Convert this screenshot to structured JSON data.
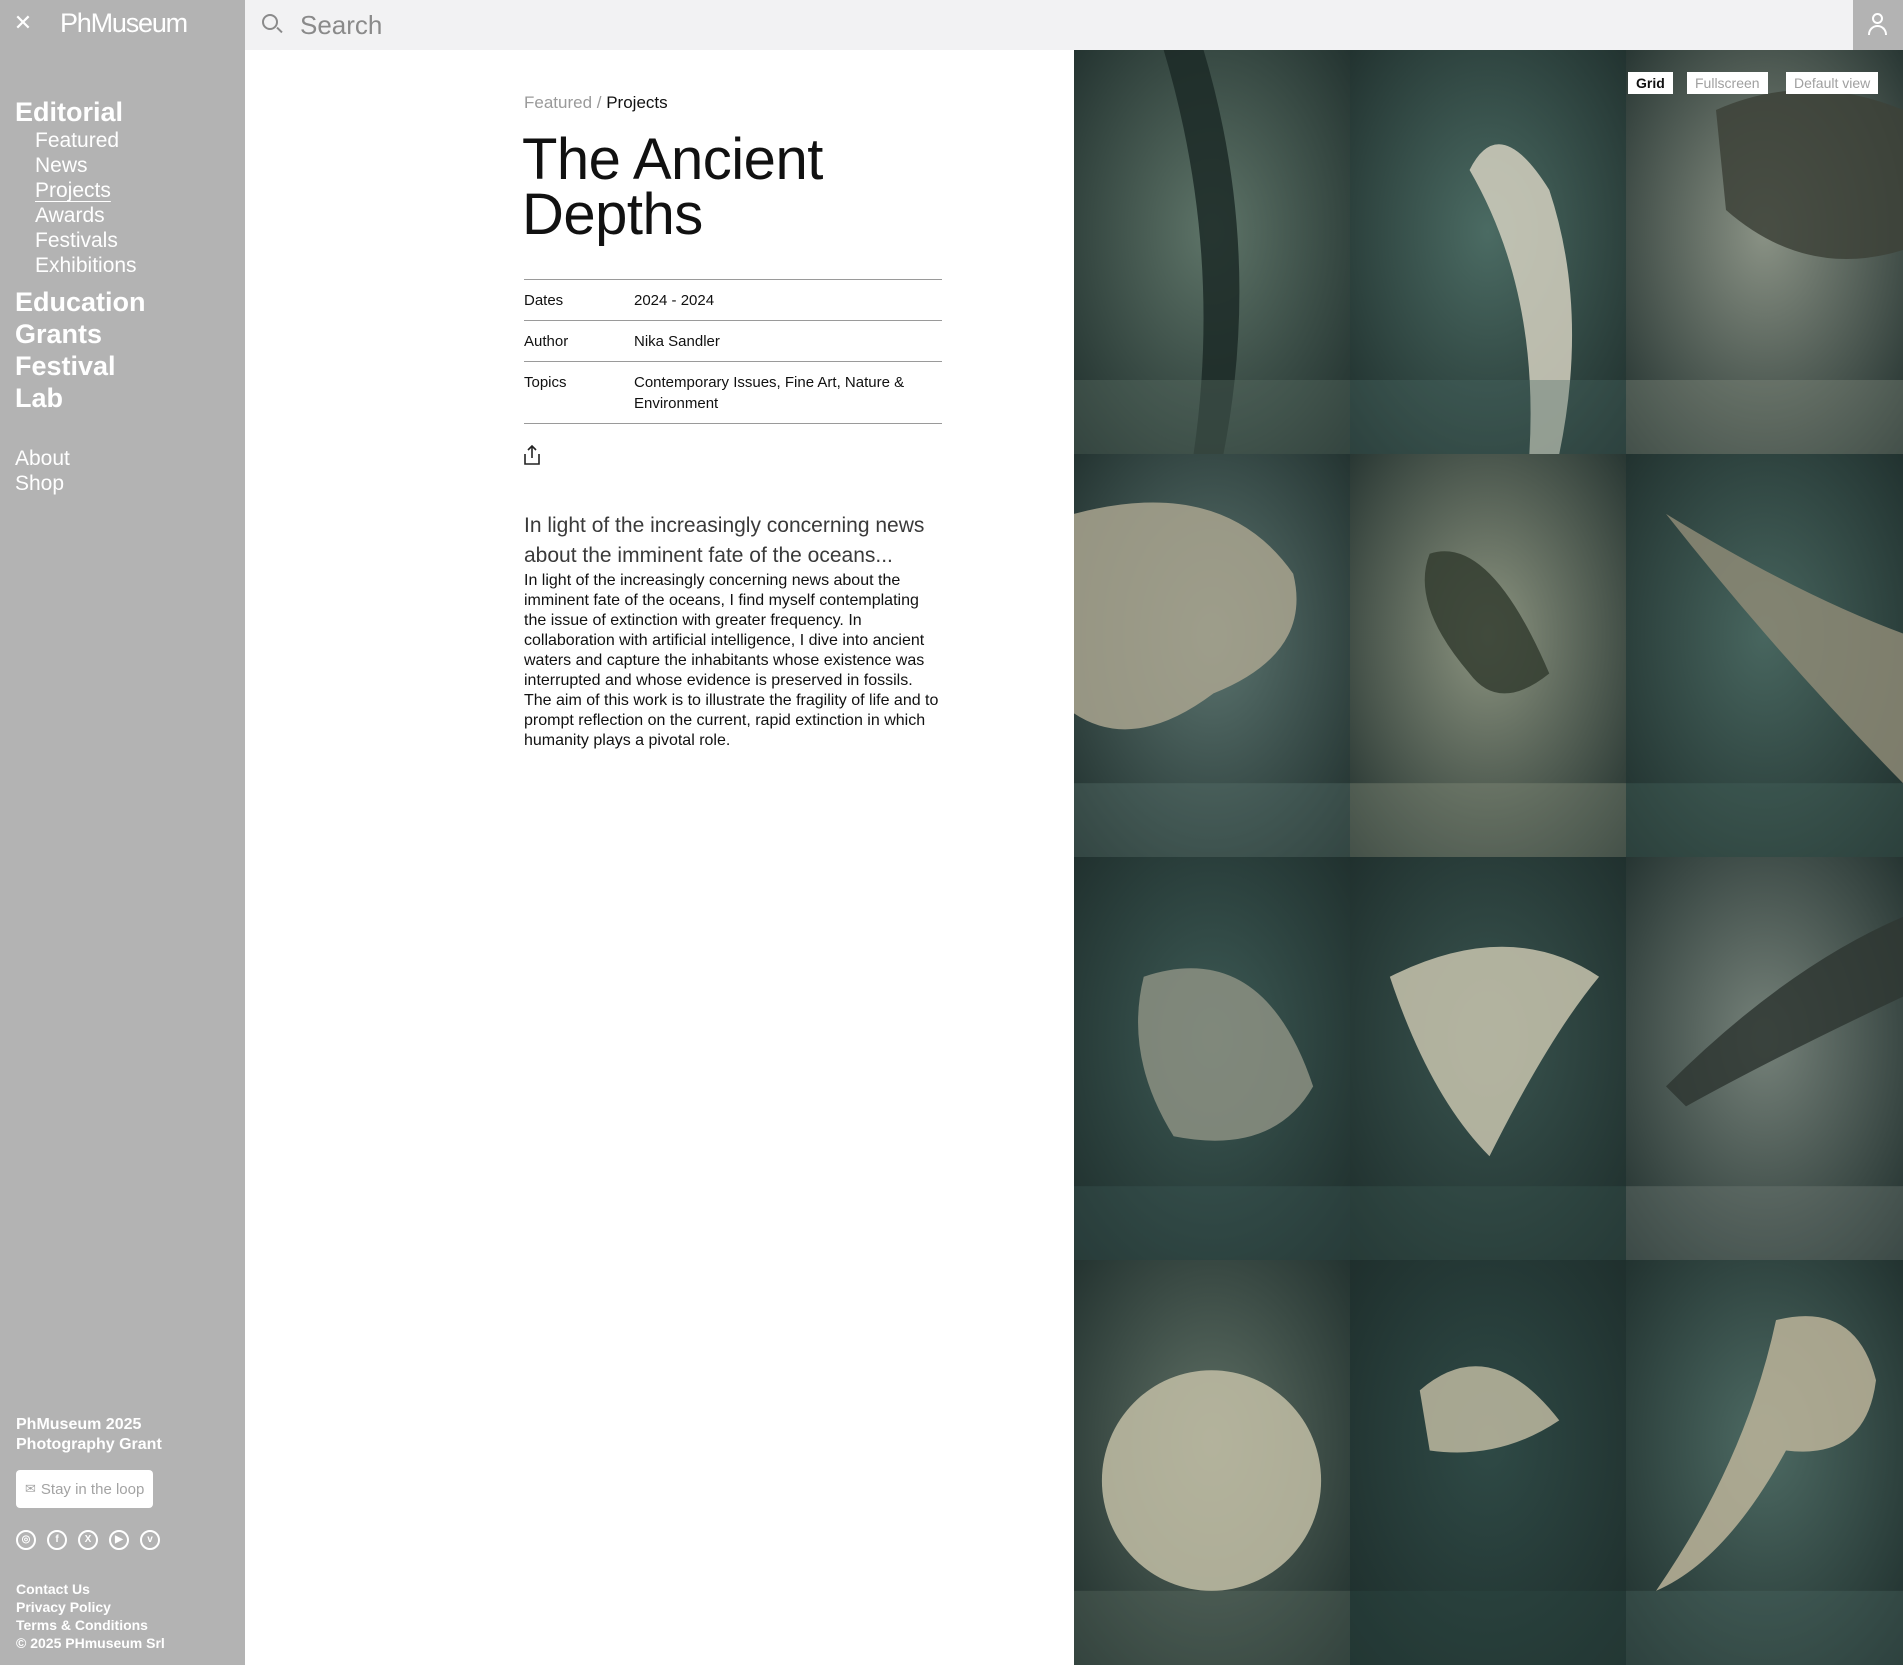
{
  "sidebar": {
    "close_icon": "✕",
    "logo": "PhMuseum",
    "editorial": "Editorial",
    "editorial_items": [
      {
        "label": "Featured"
      },
      {
        "label": "News"
      },
      {
        "label": "Projects"
      },
      {
        "label": "Awards"
      },
      {
        "label": "Festivals"
      },
      {
        "label": "Exhibitions"
      }
    ],
    "education": "Education",
    "grants": "Grants",
    "festival": "Festival",
    "lab": "Lab",
    "about": "About",
    "shop": "Shop",
    "promo_line1": "PhMuseum 2025",
    "promo_line2": "Photography Grant",
    "loop_button": "Stay in the loop",
    "socials": [
      "instagram-icon",
      "facebook-icon",
      "x-icon",
      "youtube-icon",
      "vimeo-icon"
    ],
    "footer": {
      "contact": "Contact Us",
      "privacy": "Privacy Policy",
      "terms": "Terms & Conditions",
      "copyright": "© 2025 PHmuseum Srl"
    }
  },
  "search": {
    "placeholder": "Search"
  },
  "article": {
    "breadcrumb": {
      "featured": "Featured",
      "separator": " / ",
      "projects": "Projects"
    },
    "title_line1": "The Ancient",
    "title_line2": "Depths",
    "meta": {
      "dates_label": "Dates",
      "dates_value": "2024 - 2024",
      "author_label": "Author",
      "author_value": "Nika Sandler",
      "topics_label": "Topics",
      "topics_value": "Contemporary Issues, Fine Art, Nature & Environment"
    },
    "lead": "In light of the increasingly concerning news about the imminent fate of the oceans...",
    "body": "In light of the increasingly concerning news about the imminent fate of the oceans, I find myself contemplating the issue of extinction with greater frequency. In collaboration with artificial intelligence, I dive into ancient waters and capture the inhabitants whose existence was interrupted and whose evidence is preserved in fossils. The aim of this work is to illustrate the fragility of life and to prompt reflection on the current, rapid extinction in which humanity plays a pivotal role."
  },
  "gallery": {
    "view_grid": "Grid",
    "view_fullscreen": "Fullscreen",
    "view_default": "Default view",
    "photos": [
      {
        "subject": "fossil-leaf-photo",
        "bg": "#5e7468",
        "fg": "#1c2a27"
      },
      {
        "subject": "shrimp-photo",
        "bg": "#4b6b63",
        "fg": "#d3d0c0"
      },
      {
        "subject": "fish-face-photo",
        "bg": "#8a9285",
        "fg": "#3d4238"
      },
      {
        "subject": "turtle-photo",
        "bg": "#5c7570",
        "fg": "#a9a58f"
      },
      {
        "subject": "crayfish-photo",
        "bg": "#8c9480",
        "fg": "#343d30"
      },
      {
        "subject": "ichthyosaur-photo",
        "bg": "#48665f",
        "fg": "#8d8a76"
      },
      {
        "subject": "trilobite-photo",
        "bg": "#3d5a55",
        "fg": "#8c9183"
      },
      {
        "subject": "sea-creature-photo",
        "bg": "#3a5550",
        "fg": "#c8c4ae"
      },
      {
        "subject": "crocodile-fossil-photo",
        "bg": "#76827a",
        "fg": "#2f3733"
      },
      {
        "subject": "ammonite-photo",
        "bg": "#5f7065",
        "fg": "#c2bea6"
      },
      {
        "subject": "jellyfish-photo",
        "bg": "#2f4a46",
        "fg": "#bdb8a0"
      },
      {
        "subject": "octopus-photo",
        "bg": "#4d6a63",
        "fg": "#bcb49a"
      }
    ]
  }
}
